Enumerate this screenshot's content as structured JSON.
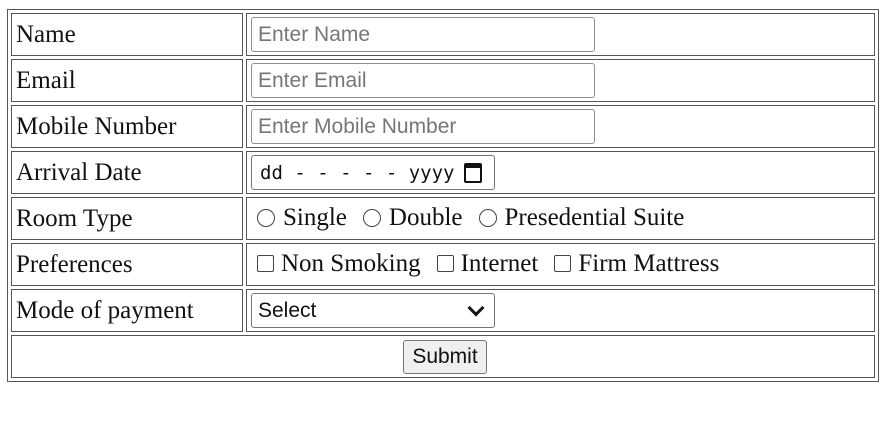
{
  "form": {
    "rows": {
      "name": {
        "label": "Name",
        "placeholder": "Enter Name",
        "value": ""
      },
      "email": {
        "label": "Email",
        "placeholder": "Enter Email",
        "value": ""
      },
      "mobile": {
        "label": "Mobile Number",
        "placeholder": "Enter Mobile Number",
        "value": ""
      },
      "arrival": {
        "label": "Arrival Date",
        "display": "dd - - - - - yyyy",
        "icon": "calendar-icon"
      },
      "room_type": {
        "label": "Room Type",
        "options": [
          "Single",
          "Double",
          "Presedential Suite"
        ],
        "selected": null
      },
      "preferences": {
        "label": "Preferences",
        "options": [
          "Non Smoking",
          "Internet",
          "Firm Mattress"
        ],
        "checked": []
      },
      "payment": {
        "label": "Mode of payment",
        "selected": "Select",
        "icon": "chevron-down-icon"
      }
    },
    "submit_label": "Submit"
  }
}
